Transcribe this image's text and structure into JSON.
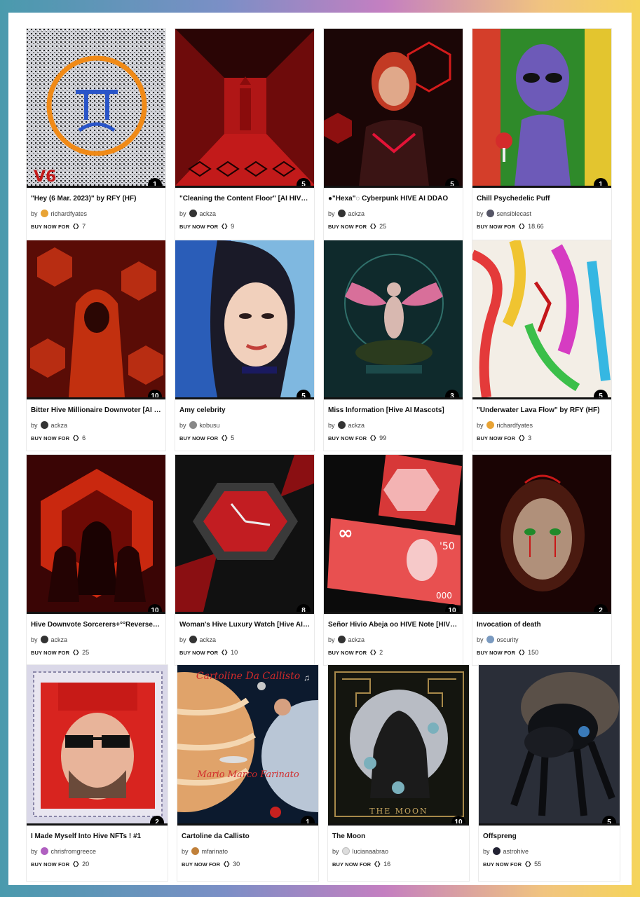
{
  "buy_label": "BUY NOW FOR",
  "by_label": "by",
  "cards": [
    {
      "title": "\"Hey (6 Mar. 2023)\" by RFY (HF)",
      "author": "richardfyates",
      "price": "7",
      "edition": "1"
    },
    {
      "title": "\"Cleaning the Content Floor\" [AI HIVE Mascots]",
      "author": "ackza",
      "price": "9",
      "edition": "5"
    },
    {
      "title": "●\"Hexa\"◌ Cyberpunk HIVE AI DDAO",
      "author": "ackza",
      "price": "25",
      "edition": "5"
    },
    {
      "title": "Chill Psychedelic Puff",
      "author": "sensiblecast",
      "price": "18.66",
      "edition": "1"
    },
    {
      "title": "Bitter Hive Millionaire Downvoter [AI Hive Mascots]",
      "author": "ackza",
      "price": "6",
      "edition": "10"
    },
    {
      "title": "Amy celebrity",
      "author": "kobusu",
      "price": "5",
      "edition": "5"
    },
    {
      "title": "Miss Information [Hive AI Mascots]",
      "author": "ackza",
      "price": "99",
      "edition": "3"
    },
    {
      "title": "\"Underwater Lava Flow\" by RFY (HF)",
      "author": "richardfyates",
      "price": "3",
      "edition": "5"
    },
    {
      "title": "Hive Downvote Sorcerers+°°Reverses°°+",
      "author": "ackza",
      "price": "25",
      "edition": "10"
    },
    {
      "title": "Woman's Hive Luxury Watch [Hive AI Mascots]",
      "author": "ackza",
      "price": "10",
      "edition": "8"
    },
    {
      "title": "Señor Hivio Abeja oo HIVE Note [HIVE AI]",
      "author": "ackza",
      "price": "2",
      "edition": "10"
    },
    {
      "title": "Invocation of death",
      "author": "oscurity",
      "price": "150",
      "edition": "2"
    },
    {
      "title": "I Made Myself Into Hive NFTs ! #1",
      "author": "chrisfromgreece",
      "price": "20",
      "edition": "2"
    },
    {
      "title": "Cartoline da Callisto",
      "author": "mfarinato",
      "price": "30",
      "edition": "1"
    },
    {
      "title": "The Moon",
      "author": "lucianaabrao",
      "price": "16",
      "edition": "10"
    },
    {
      "title": "Offspreng",
      "author": "astrohive",
      "price": "55",
      "edition": "5"
    }
  ],
  "art_text": {
    "callisto_title": "Cartoline Da Callisto",
    "callisto_author": "Mario Marco Farinato",
    "moon_caption": "THE MOON",
    "note_value": "'50",
    "note_infinity": "∞",
    "note_zeros": "000"
  },
  "colors": {
    "accent": "#111111",
    "hive_red": "#e31337"
  }
}
